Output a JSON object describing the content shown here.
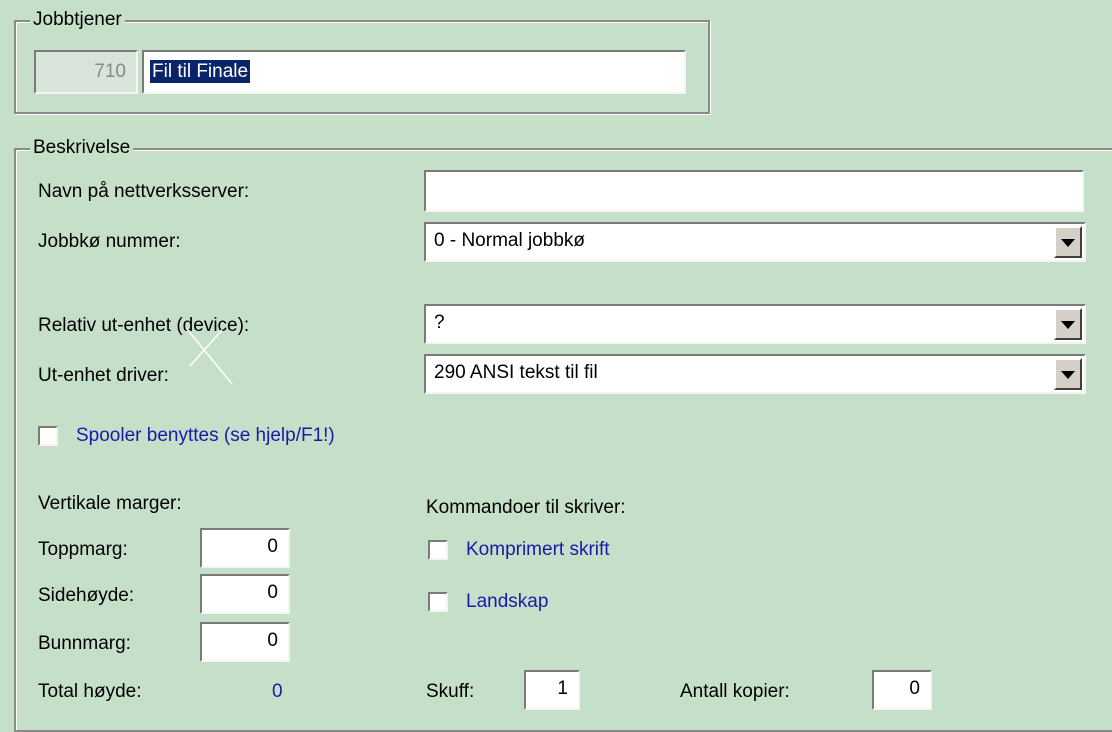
{
  "jobbtjener": {
    "legend": "Jobbtjener",
    "number": "710",
    "name": "Fil til Finale"
  },
  "beskrivelse": {
    "legend": "Beskrivelse",
    "server_label": "Navn på nettverksserver:",
    "server_value": "",
    "queue_label": "Jobbkø nummer:",
    "queue_value": "0 - Normal jobbkø",
    "device_label": "Relativ ut-enhet (device):",
    "device_value": "?",
    "driver_label": "Ut-enhet driver:",
    "driver_value": "290 ANSI tekst til fil",
    "spooler_label": "Spooler benyttes (se hjelp/F1!)"
  },
  "margins": {
    "title": "Vertikale marger:",
    "top_label": "Toppmarg:",
    "top_value": "0",
    "height_label": "Sidehøyde:",
    "height_value": "0",
    "bottom_label": "Bunnmarg:",
    "bottom_value": "0",
    "total_label": "Total høyde:",
    "total_value": "0"
  },
  "printer": {
    "title": "Kommandoer til skriver:",
    "compressed_label": "Komprimert skrift",
    "landscape_label": "Landskap",
    "tray_label": "Skuff:",
    "tray_value": "1",
    "copies_label": "Antall kopier:",
    "copies_value": "0"
  },
  "colors": {
    "background": "#c6dfc9",
    "checkbox_label": "#1a1aa8",
    "selection": "#0a246a"
  }
}
